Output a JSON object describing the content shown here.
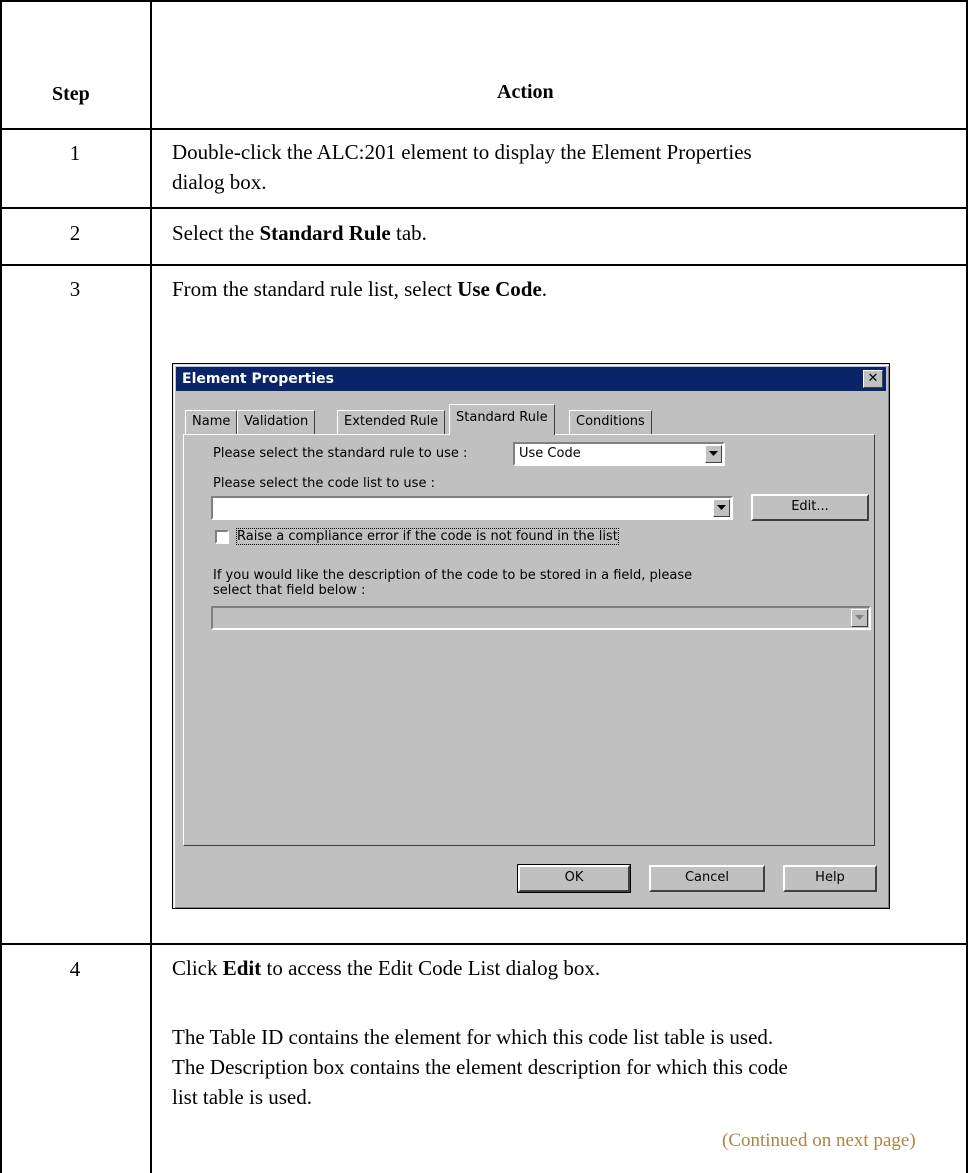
{
  "table": {
    "headers": {
      "step": "Step",
      "action": "Action"
    },
    "rows": [
      {
        "step": "1",
        "line1": "Double-click the ALC:201 element to display the Element Properties",
        "line2": "dialog box."
      },
      {
        "step": "2",
        "pre": "Select the ",
        "bold": "Standard Rule",
        "post": " tab."
      },
      {
        "step": "3",
        "pre": "From the standard rule list, select ",
        "bold": "Use Code",
        "post": "."
      },
      {
        "step": "4",
        "pre": "Click ",
        "bold": "Edit",
        "post": " to access the Edit Code List dialog box.",
        "para_lines": [
          "The Table ID contains the element for which this code list table is used.",
          "The Description box contains the element description for which this code",
          "list table is used."
        ],
        "continued": "(Continued on next page)"
      }
    ]
  },
  "dialog": {
    "title": "Element Properties",
    "tabs": [
      "Name",
      "Validation",
      "Extended Rule",
      "Standard Rule",
      "Conditions"
    ],
    "active_tab": "Standard Rule",
    "rule_label": "Please select the standard rule to use :",
    "rule_value": "Use Code",
    "codelist_label": "Please select the code list to use :",
    "codelist_value": "",
    "edit_button": "Edit...",
    "compliance_checkbox": {
      "label": "Raise a compliance error if the code is not found in the list",
      "checked": false
    },
    "description_text_line1": "If you would like the description of the code to be stored in a field, please",
    "description_text_line2": "select that field below :",
    "field_value": "",
    "buttons": {
      "ok": "OK",
      "cancel": "Cancel",
      "help": "Help"
    }
  }
}
